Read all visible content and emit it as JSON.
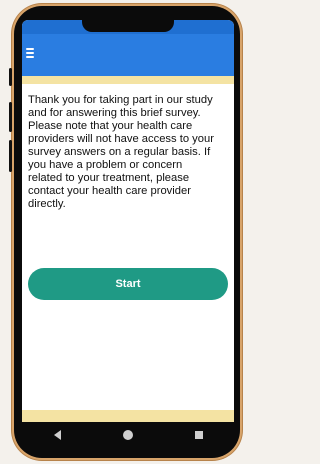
{
  "colors": {
    "status_bar": "#1f6fd1",
    "app_bar": "#2a7de1",
    "accent_strip": "#f4e3a3",
    "start_button": "#1f9a85"
  },
  "icons": {
    "menu": "hamburger-menu-icon",
    "back": "back-triangle-icon",
    "home": "home-circle-icon",
    "recents": "recents-square-icon"
  },
  "message_lines": [
    "Thank you for taking part in our study",
    "and for answering this brief survey.",
    "Please note that your health care",
    "providers will not have access to your",
    "survey answers on a regular basis.  If",
    "you have a problem or concern",
    "related to your treatment, please",
    "contact your health care provider",
    "directly."
  ],
  "start_button_label": "Start"
}
